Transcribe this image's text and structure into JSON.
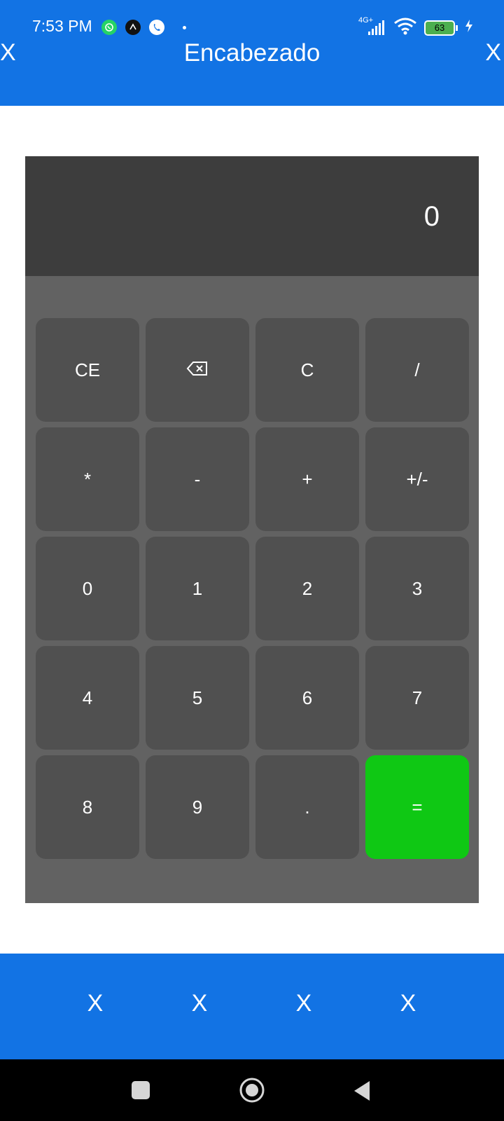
{
  "status_bar": {
    "time": "7:53 PM",
    "network": "4G+",
    "battery": "63",
    "icons": [
      "whatsapp-icon",
      "app-icon",
      "phone-icon",
      "signal-icon",
      "wifi-icon",
      "battery-icon",
      "charging-icon"
    ]
  },
  "header": {
    "title": "Encabezado",
    "close_left": "X",
    "close_right": "X"
  },
  "calculator": {
    "display": "0",
    "keys": [
      "CE",
      "⌫",
      "C",
      "/",
      "*",
      "-",
      "+",
      "+/-",
      "0",
      "1",
      "2",
      "3",
      "4",
      "5",
      "6",
      "7",
      "8",
      "9",
      ".",
      "="
    ],
    "equals_color": "#0fc814"
  },
  "bottom_bar": {
    "items": [
      "X",
      "X",
      "X",
      "X"
    ]
  },
  "nav_bar": {
    "icons": [
      "recent-apps-icon",
      "home-icon",
      "back-icon"
    ]
  },
  "colors": {
    "primary": "#1273e4",
    "display": "#3d3d3d",
    "keypad": "#626262",
    "key": "#505050"
  }
}
